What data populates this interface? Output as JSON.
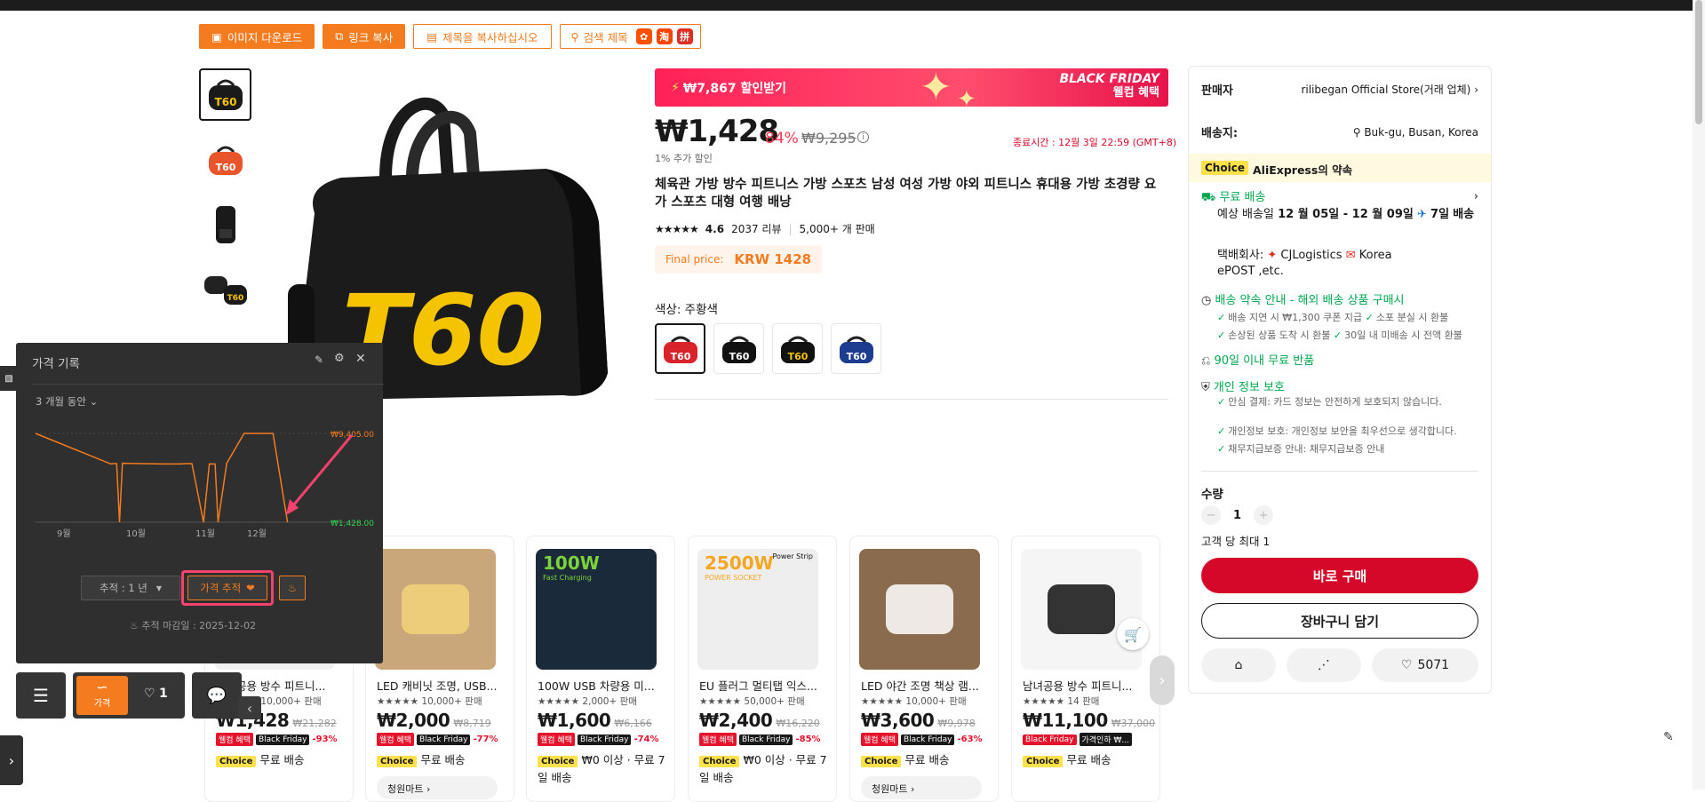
{
  "toolbar": {
    "download_images": "이미지 다운로드",
    "copy_link": "링크 복사",
    "copy_title": "제목을 복사하십시오",
    "search_title": "검색 제목",
    "icon_tao": "淘",
    "icon_pin": "拼"
  },
  "promo": {
    "coupon": "₩7,867 할인받기",
    "event_line1": "BLACK FRIDAY",
    "event_line2": "웰컴 혜택"
  },
  "price": {
    "current": "₩1,428",
    "discount": "84%",
    "original": "₩9,295",
    "extra_discount": "1% 추가 할인",
    "end_time": "종료시간 : 12월 3일 22:59 (GMT+8)",
    "final_label": "Final price:",
    "final_value": "KRW 1428"
  },
  "product": {
    "title": "체육관 가방 방수 피트니스 가방 스포츠 남성 여성 가방 야외 피트니스 휴대용 가방 초경량 요가 스포츠 대형 여행 배낭",
    "rating": "4.6",
    "reviews": "2037 리뷰",
    "sold": "5,000+ 개 판매",
    "color_label": "색상: 주황색",
    "logo_text": "T60"
  },
  "swatch_colors": [
    "#d8232a",
    "#111111",
    "#f5c400",
    "#1d3c8f"
  ],
  "seller": {
    "label": "판매자",
    "name": "rilibegan Official Store(거래 업체)",
    "ship_to_label": "배송지:",
    "ship_to": "Buk-gu, Busan, Korea",
    "choice_badge": "Choice",
    "promise": "AliExpress의 약속",
    "free_shipping": "무료 배송",
    "eta_prefix": "예상 배송일",
    "eta_range": "12 월 05일 - 12 월 09일",
    "eta_days": "7일",
    "eta_suffix": "배송",
    "carrier_prefix": "택배회사:",
    "carrier_1": "CJLogistics",
    "carrier_2": "Korea",
    "carrier_3": "ePOST ,etc.",
    "delivery_guarantee": "배송 약속 안내 - 해외 배송 상품 구매시",
    "g1": "배송 지연 시 ₩1,300 쿠폰 지급",
    "g2": "소포 분실 시 환불",
    "g3": "손상된 상품 도착 시 환불",
    "g4": "30일 내 미배송 시 전액 환불",
    "free_return": "90일 이내 무료 반품",
    "privacy": "개인 정보 보호",
    "p1": "안심 결제: 카드 정보는 안전하게 보호되지 않습니다.",
    "p2": "개인정보 보호: 개인정보 보안을 최우선으로 생각합니다.",
    "p3": "채무지급보증 안내: 채무지급보증 안내",
    "qty_label": "수량",
    "qty_value": "1",
    "qty_limit": "고객 당 최대 1",
    "buy_now": "바로 구매",
    "add_cart": "장바구니 담기",
    "wishlist_count": "5071"
  },
  "cards": [
    {
      "title": "남녀공용 방수 피트니...",
      "sold": "10,000+ 판매",
      "price": "₩1,428",
      "orig": "₩21,282",
      "off": "-93%",
      "b1": "웰컴 혜택",
      "b2": "Black Friday",
      "ship": "무료 배송",
      "store": "",
      "bg": "#f0f0f0",
      "accent": "#111"
    },
    {
      "title": "LED 캐비닛 조명, USB...",
      "sold": "10,000+ 판매",
      "price": "₩2,000",
      "orig": "₩8,719",
      "off": "-77%",
      "b1": "웰컴 혜택",
      "b2": "Black Friday",
      "ship": "무료 배송",
      "store": "청원마트",
      "bg": "#c9a77a",
      "accent": "#f5d37a"
    },
    {
      "title": "100W USB 차량용 미...",
      "sold": "2,000+ 판매",
      "price": "₩1,600",
      "orig": "₩6,166",
      "off": "-74%",
      "b1": "웰컴 혜택",
      "b2": "Black Friday",
      "ship": "₩0 이상 · 무료 7일 배송",
      "store": "",
      "bg": "#1b2a3a",
      "accent": "#7cd23a",
      "tag": "100W",
      "tag2": "Fast Charging"
    },
    {
      "title": "EU 플러그 멀티탭 익스...",
      "sold": "50,000+ 판매",
      "price": "₩2,400",
      "orig": "₩16,220",
      "off": "-85%",
      "b1": "웰컴 혜택",
      "b2": "Black Friday",
      "ship": "₩0 이상 · 무료 7일 배송",
      "store": "",
      "bg": "#eeeeee",
      "accent": "#f5a623",
      "tag": "2500W",
      "tag2": "POWER SOCKET",
      "tag3": "Power Strip"
    },
    {
      "title": "LED 야간 조명 책상 램...",
      "sold": "10,000+ 판매",
      "price": "₩3,600",
      "orig": "₩9,978",
      "off": "-63%",
      "b1": "웰컴 혜택",
      "b2": "Black Friday",
      "ship": "무료 배송",
      "store": "청원마트",
      "bg": "#8a6b4e",
      "accent": "#fff"
    },
    {
      "title": "남녀공용 방수 피트니...",
      "sold": "14 판매",
      "price": "₩11,100",
      "orig": "₩37,000",
      "off": "",
      "b1": "Black Friday",
      "b2": "가격인하 ₩...",
      "ship": "무료 배송",
      "store": "",
      "bg": "#f5f5f5",
      "accent": "#111"
    }
  ],
  "choice_label": "Choice",
  "price_history": {
    "title": "가격 기록",
    "period": "3 개월 동안",
    "max_label": "₩9,405.00",
    "min_label": "₩1,428.00",
    "months": [
      "9월",
      "10월",
      "11월",
      "12월"
    ],
    "track_period": "추적 : 1 년",
    "track_button": "가격 추적",
    "deadline": "추적 마감일 : 2025-12-02",
    "series": [
      9405,
      8900,
      8900,
      8950,
      8950,
      1428,
      9000,
      8900,
      8900,
      8950,
      8950,
      1428,
      8900,
      8900,
      1428,
      9000,
      9405,
      9405,
      9405,
      1428
    ]
  },
  "bottom": {
    "price_tab": "가격",
    "like_count": "1"
  }
}
